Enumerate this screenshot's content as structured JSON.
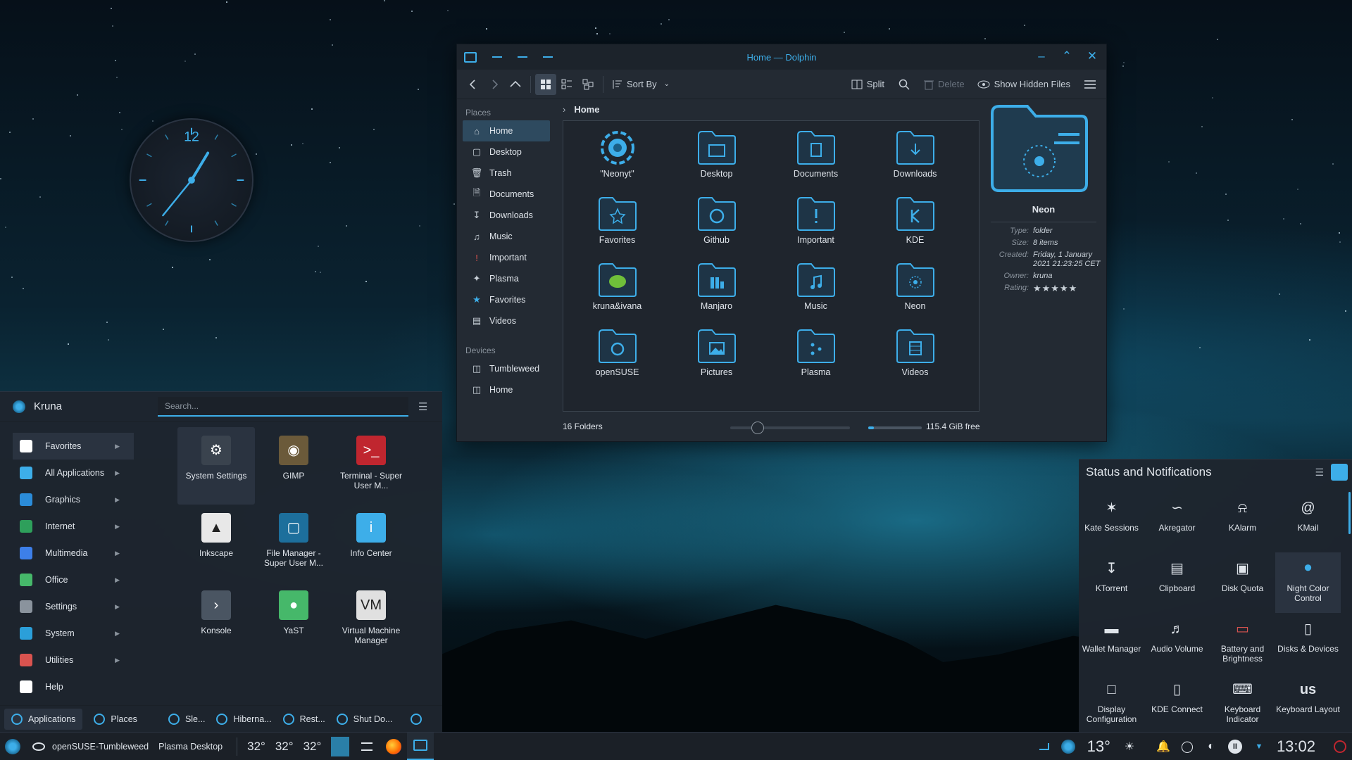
{
  "clock": {
    "hour": 1,
    "minute": 2,
    "label": "12"
  },
  "dolphin": {
    "title": "Home — Dolphin",
    "toolbar": {
      "sort_by": "Sort By",
      "split": "Split",
      "delete": "Delete",
      "show_hidden": "Show Hidden Files"
    },
    "places_header": "Places",
    "places": [
      {
        "label": "Home",
        "icon": "home-icon",
        "selected": true
      },
      {
        "label": "Desktop",
        "icon": "desktop-icon"
      },
      {
        "label": "Trash",
        "icon": "trash-icon"
      },
      {
        "label": "Documents",
        "icon": "documents-icon"
      },
      {
        "label": "Downloads",
        "icon": "downloads-icon"
      },
      {
        "label": "Music",
        "icon": "music-icon"
      },
      {
        "label": "Important",
        "icon": "important-icon"
      },
      {
        "label": "Plasma",
        "icon": "plasma-icon"
      },
      {
        "label": "Favorites",
        "icon": "star-icon"
      },
      {
        "label": "Videos",
        "icon": "videos-icon"
      }
    ],
    "devices_header": "Devices",
    "devices": [
      {
        "label": "Tumbleweed",
        "icon": "drive-icon"
      },
      {
        "label": "Home",
        "icon": "drive-icon"
      }
    ],
    "breadcrumb": "Home",
    "items": [
      {
        "name": "\"Neonyt\"",
        "icon": "neon-logo-icon"
      },
      {
        "name": "Desktop",
        "icon": "folder-desktop-icon"
      },
      {
        "name": "Documents",
        "icon": "folder-documents-icon"
      },
      {
        "name": "Downloads",
        "icon": "folder-downloads-icon"
      },
      {
        "name": "Favorites",
        "icon": "folder-favorites-icon"
      },
      {
        "name": "Github",
        "icon": "folder-github-icon"
      },
      {
        "name": "Important",
        "icon": "folder-important-icon"
      },
      {
        "name": "KDE",
        "icon": "folder-kde-icon"
      },
      {
        "name": "kruna&ivana",
        "icon": "folder-chameleon-icon"
      },
      {
        "name": "Manjaro",
        "icon": "folder-manjaro-icon"
      },
      {
        "name": "Music",
        "icon": "folder-music-icon"
      },
      {
        "name": "Neon",
        "icon": "folder-neon-icon"
      },
      {
        "name": "openSUSE",
        "icon": "folder-opensuse-icon"
      },
      {
        "name": "Pictures",
        "icon": "folder-pictures-icon"
      },
      {
        "name": "Plasma",
        "icon": "folder-plasma-icon"
      },
      {
        "name": "Videos",
        "icon": "folder-videos-icon"
      }
    ],
    "info": {
      "name": "Neon",
      "rows": [
        {
          "k": "Type:",
          "v": "folder"
        },
        {
          "k": "Size:",
          "v": "8 items"
        },
        {
          "k": "Created:",
          "v": "Friday, 1 January 2021 21:23:25 CET"
        },
        {
          "k": "Owner:",
          "v": "kruna"
        }
      ],
      "rating_label": "Rating:",
      "rating": 5,
      "rating_stars": "★★★★★"
    },
    "status": {
      "count": "16 Folders",
      "free": "115.4 GiB free",
      "zoom_fraction": 0.23,
      "used_fraction": 0.1
    }
  },
  "launcher": {
    "user": "Kruna",
    "search_placeholder": "Search...",
    "categories": [
      {
        "label": "Favorites",
        "color": "#ffffff",
        "selected": true
      },
      {
        "label": "All Applications",
        "color": "#3daee9"
      },
      {
        "label": "Graphics",
        "color": "#2b8cd9"
      },
      {
        "label": "Internet",
        "color": "#2e9f5b"
      },
      {
        "label": "Multimedia",
        "color": "#3d7fe9"
      },
      {
        "label": "Office",
        "color": "#46b86a"
      },
      {
        "label": "Settings",
        "color": "#8a939d"
      },
      {
        "label": "System",
        "color": "#2b9fd9"
      },
      {
        "label": "Utilities",
        "color": "#d9534f"
      },
      {
        "label": "Help",
        "color": "#ffffff"
      }
    ],
    "apps": [
      {
        "label": "System Settings",
        "icon": "settings-icon",
        "bg": "#3a434e",
        "selected": true
      },
      {
        "label": "GIMP",
        "icon": "gimp-icon",
        "bg": "#6b5a3a"
      },
      {
        "label": "Terminal - Super User M...",
        "icon": "terminal-icon",
        "bg": "#c0262f"
      },
      {
        "label": "Inkscape",
        "icon": "inkscape-icon",
        "bg": "#e8e8e8"
      },
      {
        "label": "File Manager - Super User M...",
        "icon": "folder-icon",
        "bg": "#1d6f9c"
      },
      {
        "label": "Info Center",
        "icon": "info-icon",
        "bg": "#3daee9"
      },
      {
        "label": "Konsole",
        "icon": "konsole-icon",
        "bg": "#4a5562"
      },
      {
        "label": "YaST",
        "icon": "yast-icon",
        "bg": "#46b86a"
      },
      {
        "label": "Virtual Machine Manager",
        "icon": "vm-icon",
        "bg": "#e0e0e0"
      }
    ],
    "footer": {
      "applications": "Applications",
      "places": "Places",
      "sleep": "Sle...",
      "hibernate": "Hiberna...",
      "restart": "Rest...",
      "shutdown": "Shut Do..."
    }
  },
  "tray": {
    "title": "Status and Notifications",
    "items": [
      {
        "label": "Kate Sessions",
        "icon": "kate-icon"
      },
      {
        "label": "Akregator",
        "icon": "rss-icon"
      },
      {
        "label": "KAlarm",
        "icon": "bell-icon"
      },
      {
        "label": "KMail",
        "icon": "at-icon"
      },
      {
        "label": "KTorrent",
        "icon": "download-icon"
      },
      {
        "label": "Clipboard",
        "icon": "clipboard-icon"
      },
      {
        "label": "Disk Quota",
        "icon": "disk-quota-icon"
      },
      {
        "label": "Night Color Control",
        "icon": "night-color-icon",
        "selected": true
      },
      {
        "label": "Wallet Manager",
        "icon": "wallet-icon"
      },
      {
        "label": "Audio Volume",
        "icon": "speaker-icon"
      },
      {
        "label": "Battery and Brightness",
        "icon": "battery-icon"
      },
      {
        "label": "Disks & Devices",
        "icon": "disk-icon"
      },
      {
        "label": "Display Configuration",
        "icon": "display-icon"
      },
      {
        "label": "KDE Connect",
        "icon": "phone-icon"
      },
      {
        "label": "Keyboard Indicator",
        "icon": "keyboard-icon"
      },
      {
        "label": "Keyboard Layout",
        "icon": "keyboard-layout-icon",
        "glyph": "us"
      }
    ]
  },
  "taskbar": {
    "distro": "openSUSE-Tumbleweed",
    "desktop": "Plasma Desktop",
    "temps": [
      "32°",
      "32°",
      "32°"
    ],
    "weather_temp": "13°",
    "time": "13:02"
  },
  "accent": "#3daee9"
}
